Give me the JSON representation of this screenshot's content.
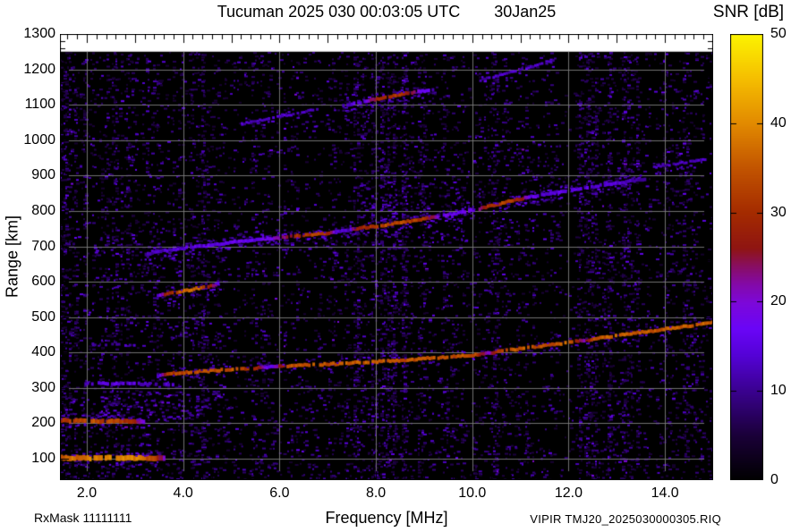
{
  "header": {
    "title": "Tucuman 2025 030 00:03:05 UTC",
    "date": "30Jan25"
  },
  "footer": {
    "rx_mask": "RxMask 11111111",
    "file_label": "VIPIR  TMJ20_2025030000305.RIQ"
  },
  "chart_data": {
    "type": "heatmap",
    "title": "Tucuman 2025 030 00:03:05 UTC",
    "date_label": "30Jan25",
    "xlabel": "Frequency [MHz]",
    "ylabel": "Range [km]",
    "xlim": [
      1.443,
      15.0
    ],
    "ylim": [
      39.4,
      1300
    ],
    "data_top": 1250,
    "x_ticks": [
      {
        "v": 2,
        "label": "2.0"
      },
      {
        "v": 4,
        "label": "4.0"
      },
      {
        "v": 6,
        "label": "6.0"
      },
      {
        "v": 8,
        "label": "8.0"
      },
      {
        "v": 10,
        "label": "10.0"
      },
      {
        "v": 12,
        "label": "12.0"
      },
      {
        "v": 14,
        "label": "14.0"
      }
    ],
    "y_ticks": [
      {
        "v": 100,
        "label": "100"
      },
      {
        "v": 200,
        "label": "200"
      },
      {
        "v": 300,
        "label": "300"
      },
      {
        "v": 400,
        "label": "400"
      },
      {
        "v": 500,
        "label": "500"
      },
      {
        "v": 600,
        "label": "600"
      },
      {
        "v": 700,
        "label": "700"
      },
      {
        "v": 800,
        "label": "800"
      },
      {
        "v": 900,
        "label": "900"
      },
      {
        "v": 1000,
        "label": "1000"
      },
      {
        "v": 1100,
        "label": "1100"
      },
      {
        "v": 1200,
        "label": "1200"
      },
      {
        "v": 1300,
        "label": "1300"
      }
    ],
    "x_minor_step": 0.2,
    "y_minor_step": 20,
    "grid": {
      "x_step": 2,
      "y_step": 100,
      "color": "#7d7d7d"
    },
    "colorbar": {
      "title": "SNR [dB]",
      "min": 0,
      "max": 50,
      "ticks": [
        0,
        10,
        20,
        30,
        40,
        50
      ]
    },
    "colormap": [
      [
        0,
        "#000000"
      ],
      [
        5,
        "#1a0038"
      ],
      [
        10,
        "#3a018f"
      ],
      [
        14,
        "#5402d6"
      ],
      [
        17,
        "#6a05f7"
      ],
      [
        20,
        "#7d08d8"
      ],
      [
        22,
        "#8309a8"
      ],
      [
        24,
        "#880e62"
      ],
      [
        26,
        "#8f1512"
      ],
      [
        30,
        "#a42b00"
      ],
      [
        35,
        "#c25400"
      ],
      [
        40,
        "#e28a00"
      ],
      [
        45,
        "#f5be00"
      ],
      [
        50,
        "#fcf400"
      ]
    ],
    "noise": {
      "seed": 20250130,
      "base_density": 0.028,
      "dot_snr": [
        4,
        17
      ],
      "bands": [
        {
          "f": [
            1.44,
            5.0
          ],
          "boost": 0.5
        },
        {
          "f": [
            1.44,
            1.8
          ],
          "boost": 1.0
        },
        {
          "f": [
            2.0,
            2.2
          ],
          "boost": 0.8
        },
        {
          "f": [
            2.4,
            2.6
          ],
          "boost": 0.6
        },
        {
          "f": [
            3.2,
            3.45
          ],
          "boost": 0.8
        },
        {
          "f": [
            4.3,
            4.5
          ],
          "boost": 0.9
        },
        {
          "f": [
            5.35,
            5.55
          ],
          "boost": 0.7
        },
        {
          "f": [
            6.2,
            6.4
          ],
          "boost": 0.8
        },
        {
          "f": [
            7.0,
            7.15
          ],
          "boost": 0.6
        },
        {
          "f": [
            7.5,
            8.65
          ],
          "boost": 1.8
        },
        {
          "f": [
            8.8,
            9.0
          ],
          "boost": 0.7
        },
        {
          "f": [
            9.25,
            9.5
          ],
          "boost": 0.9
        },
        {
          "f": [
            10.3,
            10.7
          ],
          "boost": 1.0
        },
        {
          "f": [
            11.1,
            11.25
          ],
          "boost": 0.6
        },
        {
          "f": [
            12.2,
            12.6
          ],
          "boost": 1.6
        },
        {
          "f": [
            12.8,
            13.45
          ],
          "boost": 1.6
        },
        {
          "f": [
            13.9,
            14.05
          ],
          "boost": 0.8
        },
        {
          "f": [
            14.3,
            14.45
          ],
          "boost": 0.6
        },
        {
          "f": [
            14.6,
            14.8
          ],
          "boost": 0.7
        }
      ],
      "clouds": [
        {
          "f": [
            1.5,
            4.8
          ],
          "r": [
            210,
            292
          ],
          "d": 0.1,
          "snr": [
            8,
            19
          ]
        },
        {
          "f": [
            3.0,
            4.8
          ],
          "r": [
            428,
            505
          ],
          "d": 0.055,
          "snr": [
            7,
            16
          ]
        },
        {
          "f": [
            2.1,
            7.6
          ],
          "r": [
            615,
            748
          ],
          "d": 0.05,
          "snr": [
            7,
            16
          ]
        },
        {
          "f": [
            7.5,
            9.9
          ],
          "r": [
            690,
            888
          ],
          "d": 0.075,
          "snr": [
            8,
            17
          ]
        },
        {
          "f": [
            10.2,
            12.0
          ],
          "r": [
            630,
            1010
          ],
          "d": 0.028,
          "snr": [
            6,
            14
          ]
        },
        {
          "f": [
            5.9,
            9.4
          ],
          "r": [
            1035,
            1150
          ],
          "d": 0.03,
          "snr": [
            6,
            15
          ]
        },
        {
          "f": [
            11.3,
            13.6
          ],
          "r": [
            845,
            935
          ],
          "d": 0.035,
          "snr": [
            7,
            14
          ]
        },
        {
          "f": [
            1.45,
            15.0
          ],
          "r": [
            40,
            310
          ],
          "d": 0.03,
          "snr": [
            5,
            13
          ]
        }
      ]
    },
    "traces": [
      {
        "name": "E-region echo ~100 km",
        "width": 6,
        "halo": 2,
        "points": [
          [
            1.45,
            102,
            36
          ],
          [
            2.0,
            102,
            38
          ],
          [
            2.6,
            103,
            40
          ],
          [
            3.1,
            102,
            38
          ],
          [
            3.45,
            102,
            30
          ],
          [
            3.62,
            102,
            16
          ]
        ]
      },
      {
        "name": "E-region 2nd echo ~205 km",
        "width": 5,
        "halo": 2,
        "points": [
          [
            1.45,
            208,
            30
          ],
          [
            1.8,
            207,
            34
          ],
          [
            2.4,
            206,
            33
          ],
          [
            2.9,
            206,
            29
          ],
          [
            3.2,
            205,
            17
          ]
        ]
      },
      {
        "name": "faint echo ~310 km",
        "width": 4,
        "gap": 0.45,
        "points": [
          [
            1.95,
            313,
            14
          ],
          [
            2.5,
            312,
            15
          ],
          [
            3.1,
            311,
            14
          ],
          [
            3.85,
            310,
            13
          ]
        ]
      },
      {
        "name": "faint echo ~420 km",
        "width": 3,
        "gap": 0.5,
        "points": [
          [
            2.1,
            423,
            12
          ],
          [
            3.05,
            420,
            11
          ]
        ]
      },
      {
        "name": "F-region main trace",
        "width": 4,
        "halo": 1,
        "points": [
          [
            3.45,
            334,
            14
          ],
          [
            3.65,
            340,
            30
          ],
          [
            4.0,
            343,
            34
          ],
          [
            4.5,
            348,
            35
          ],
          [
            5.0,
            352,
            34
          ],
          [
            5.5,
            356,
            30
          ],
          [
            5.8,
            360,
            15
          ],
          [
            6.1,
            362,
            33
          ],
          [
            6.5,
            364,
            35
          ],
          [
            7.0,
            367,
            34
          ],
          [
            7.5,
            371,
            35
          ],
          [
            8.0,
            374,
            36
          ],
          [
            8.5,
            378,
            34
          ],
          [
            9.0,
            383,
            35
          ],
          [
            9.5,
            388,
            33
          ],
          [
            10.0,
            393,
            35
          ],
          [
            10.3,
            398,
            20
          ],
          [
            10.6,
            404,
            34
          ],
          [
            11.0,
            411,
            35
          ],
          [
            11.5,
            420,
            34
          ],
          [
            12.0,
            429,
            36
          ],
          [
            12.3,
            434,
            20
          ],
          [
            12.5,
            438,
            35
          ],
          [
            13.0,
            448,
            36
          ],
          [
            13.5,
            457,
            35
          ],
          [
            14.0,
            467,
            36
          ],
          [
            14.5,
            476,
            35
          ],
          [
            15.0,
            485,
            36
          ]
        ]
      },
      {
        "name": "oblique segment ~570 km",
        "width": 4,
        "halo": 1,
        "points": [
          [
            3.45,
            560,
            14
          ],
          [
            3.6,
            565,
            26
          ],
          [
            3.8,
            570,
            33
          ],
          [
            4.0,
            574,
            36
          ],
          [
            4.15,
            578,
            40
          ],
          [
            4.35,
            583,
            34
          ],
          [
            4.55,
            588,
            26
          ],
          [
            4.75,
            596,
            15
          ]
        ]
      },
      {
        "name": "second-hop F trace",
        "width": 4,
        "halo": 2,
        "points": [
          [
            3.2,
            678,
            12
          ],
          [
            3.6,
            688,
            13
          ],
          [
            4.0,
            695,
            14
          ],
          [
            4.5,
            703,
            15
          ],
          [
            5.0,
            711,
            16
          ],
          [
            5.5,
            718,
            15
          ],
          [
            6.0,
            725,
            22
          ],
          [
            6.3,
            729,
            30
          ],
          [
            6.7,
            734,
            32
          ],
          [
            7.0,
            738,
            30
          ],
          [
            7.15,
            741,
            14
          ],
          [
            7.4,
            746,
            12
          ],
          [
            7.55,
            750,
            26
          ],
          [
            8.0,
            757,
            33
          ],
          [
            8.5,
            767,
            34
          ],
          [
            9.0,
            778,
            30
          ],
          [
            9.3,
            785,
            18
          ],
          [
            9.6,
            792,
            16
          ],
          [
            10.0,
            802,
            18
          ],
          [
            10.3,
            812,
            30
          ],
          [
            10.6,
            822,
            32
          ],
          [
            10.9,
            832,
            30
          ],
          [
            11.2,
            840,
            16
          ],
          [
            11.6,
            849,
            15
          ],
          [
            12.0,
            858,
            14
          ],
          [
            12.5,
            869,
            14
          ],
          [
            13.0,
            879,
            13
          ],
          [
            13.3,
            885,
            12
          ],
          [
            13.6,
            891,
            11
          ]
        ]
      },
      {
        "name": "second-hop tail ~935 km",
        "width": 3,
        "halo": 1,
        "points": [
          [
            13.75,
            924,
            12
          ],
          [
            14.2,
            933,
            13
          ],
          [
            14.85,
            947,
            12
          ]
        ]
      },
      {
        "name": "third-hop segment a",
        "width": 3,
        "halo": 1,
        "points": [
          [
            5.2,
            1046,
            12
          ],
          [
            5.8,
            1062,
            13
          ],
          [
            6.4,
            1077,
            13
          ],
          [
            6.8,
            1089,
            12
          ]
        ]
      },
      {
        "name": "third-hop segment b",
        "width": 4,
        "halo": 2,
        "points": [
          [
            7.3,
            1097,
            13
          ],
          [
            7.7,
            1108,
            15
          ],
          [
            8.0,
            1116,
            28
          ],
          [
            8.3,
            1124,
            31
          ],
          [
            8.6,
            1131,
            29
          ],
          [
            8.9,
            1138,
            16
          ],
          [
            9.2,
            1144,
            14
          ]
        ]
      },
      {
        "name": "third-hop segment c",
        "width": 3,
        "halo": 1,
        "points": [
          [
            10.1,
            1168,
            12
          ],
          [
            10.6,
            1185,
            13
          ],
          [
            11.1,
            1203,
            13
          ],
          [
            11.7,
            1226,
            12
          ]
        ]
      }
    ]
  }
}
